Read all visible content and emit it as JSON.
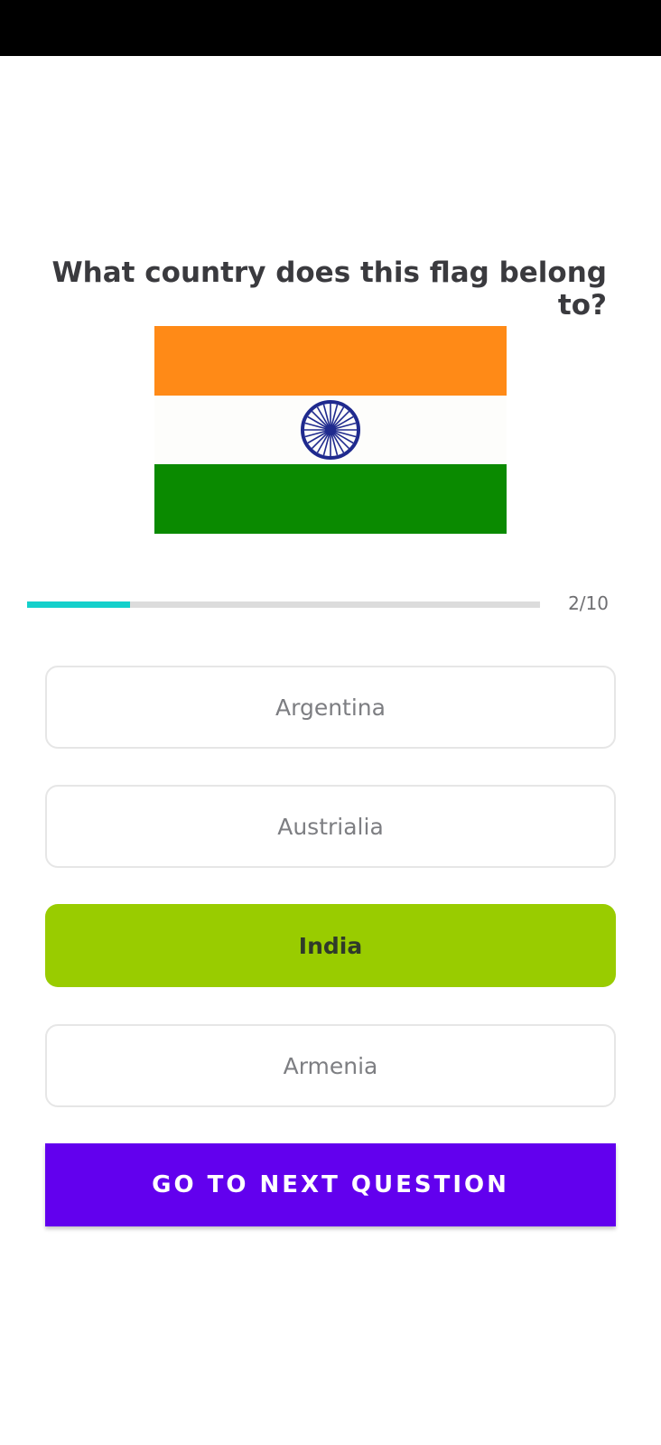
{
  "question": {
    "text": "What country does this flag belong to?"
  },
  "flag": {
    "name": "flag-of-india",
    "colors": {
      "top": "#FF8A17",
      "middle": "#FDFDFB",
      "bottom": "#0A8A00",
      "chakra": "#1F2A8E"
    }
  },
  "progress": {
    "current": 2,
    "total": 10,
    "label": "2/10",
    "fill_fraction": 0.2,
    "fill_color": "#14D0CB"
  },
  "options": [
    {
      "label": "Argentina",
      "selected": false
    },
    {
      "label": "Austrialia",
      "selected": false
    },
    {
      "label": "India",
      "selected": true
    },
    {
      "label": "Armenia",
      "selected": false
    }
  ],
  "colors": {
    "selected_option": "#99CC00",
    "next_button": "#6200EE"
  },
  "next_button": {
    "label": "GO TO NEXT QUESTION"
  }
}
